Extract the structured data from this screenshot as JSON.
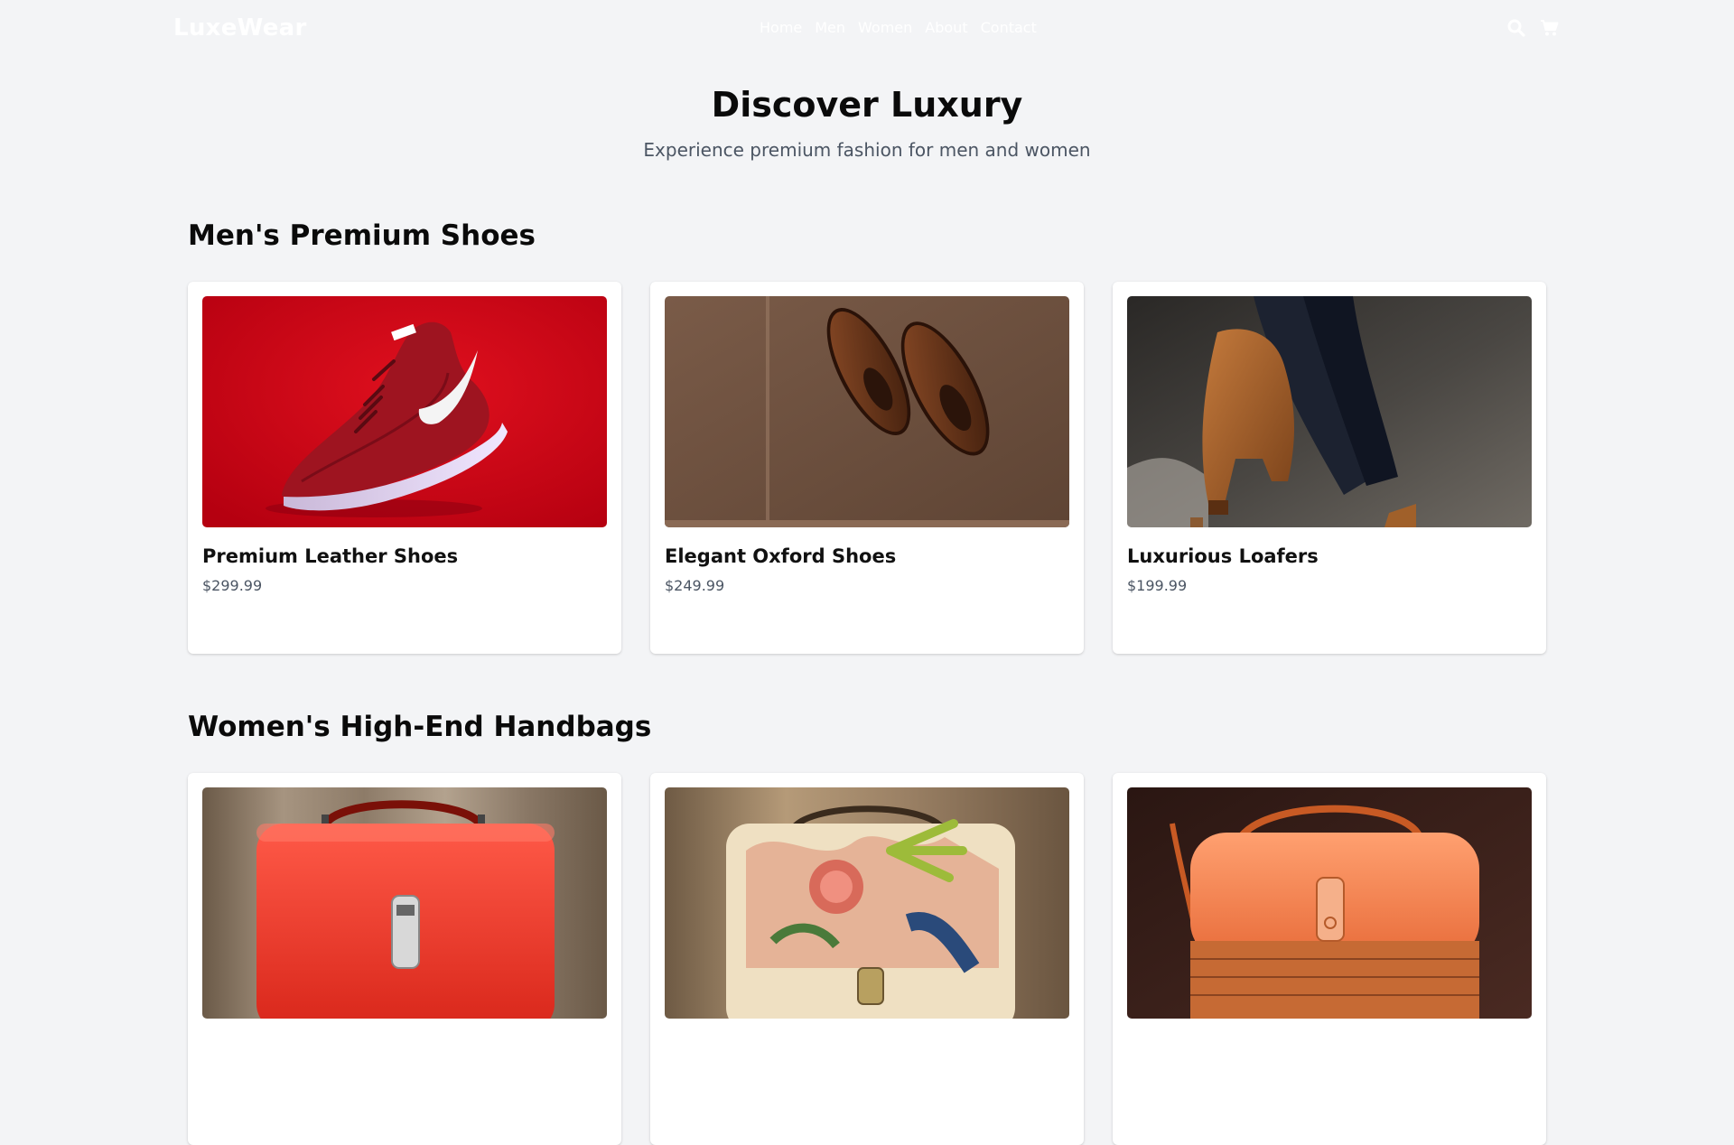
{
  "header": {
    "logo": "LuxeWear",
    "nav": [
      "Home",
      "Men",
      "Women",
      "About",
      "Contact"
    ],
    "icons": [
      "search-icon",
      "cart-icon"
    ]
  },
  "hero": {
    "title": "Discover Luxury",
    "subtitle": "Experience premium fashion for men and women"
  },
  "sections": [
    {
      "title": "Men's Premium Shoes",
      "products": [
        {
          "name": "Premium Leather Shoes",
          "price": "$299.99"
        },
        {
          "name": "Elegant Oxford Shoes",
          "price": "$249.99"
        },
        {
          "name": "Luxurious Loafers",
          "price": "$199.99"
        }
      ]
    },
    {
      "title": "Women's High-End Handbags",
      "products": [
        {
          "name": "",
          "price": ""
        },
        {
          "name": "",
          "price": ""
        },
        {
          "name": "",
          "price": ""
        }
      ]
    }
  ],
  "colors": {
    "background": "#f3f4f6",
    "card": "#ffffff",
    "text": "#111111",
    "muted": "#4b5563"
  }
}
